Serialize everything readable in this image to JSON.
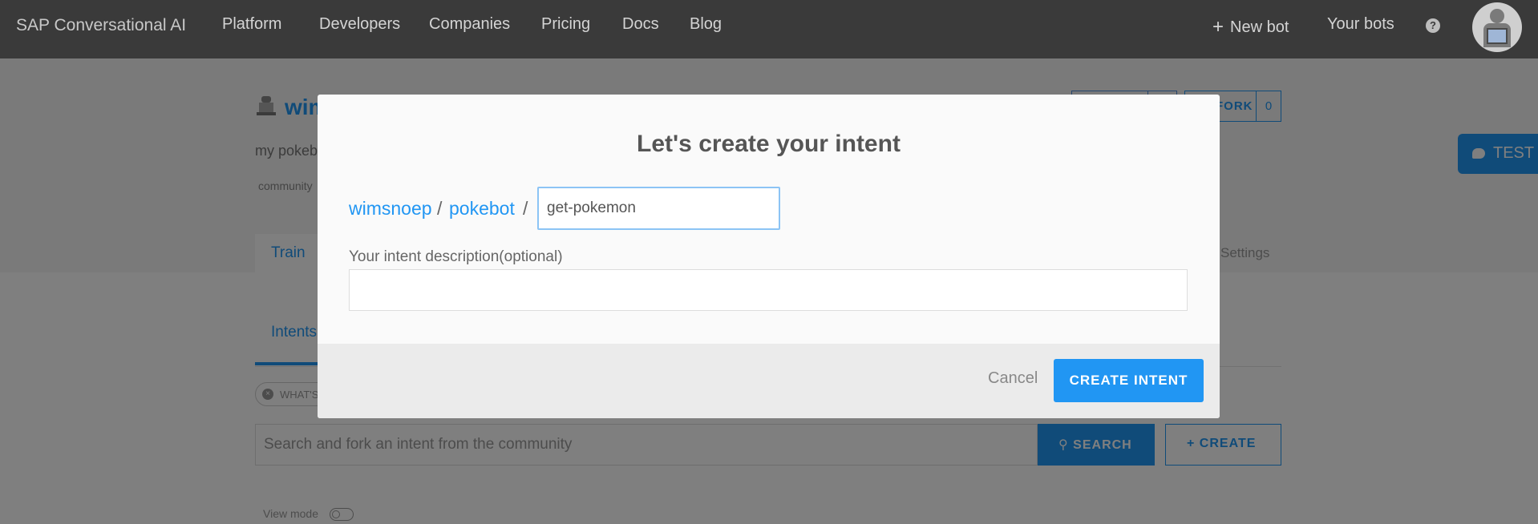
{
  "nav": {
    "brand": "SAP Conversational AI",
    "links": [
      "Platform",
      "Developers",
      "Companies",
      "Pricing",
      "Docs",
      "Blog"
    ],
    "new_bot": "New bot",
    "your_bots": "Your bots",
    "help": "?"
  },
  "bot": {
    "name": "wimsnoep",
    "description": "my pokebot",
    "tag": "community",
    "fork_label": "FORK",
    "fork_count": "0",
    "test_label": "TEST"
  },
  "tabs": {
    "train": "Train",
    "settings": "Settings"
  },
  "intents": {
    "subtab": "Intents",
    "chip": "WHAT'S",
    "search_placeholder": "Search and fork an intent from the community",
    "search_label": "SEARCH",
    "create_label": "+ CREATE",
    "view_mode": "View mode"
  },
  "modal": {
    "title": "Let's create your intent",
    "crumb_user": "wimsnoep",
    "crumb_sep": "/",
    "crumb_bot": "pokebot",
    "intent_name_value": "get-pokemon",
    "desc_label": "Your intent description(optional)",
    "desc_value": "",
    "cancel_label": "Cancel",
    "create_label": "CREATE INTENT"
  },
  "colors": {
    "accent": "#2196f3",
    "nav_bg": "#3a3a3a"
  }
}
